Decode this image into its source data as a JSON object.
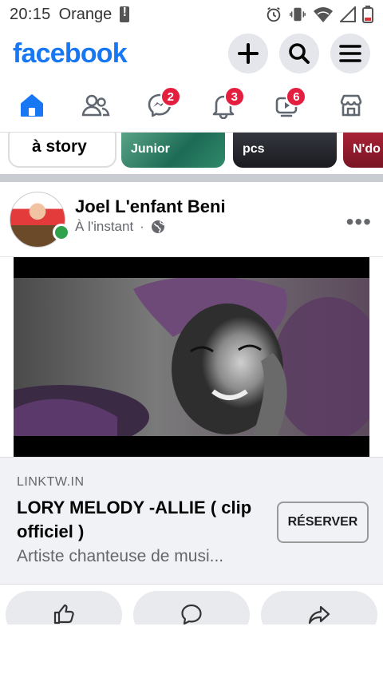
{
  "status_bar": {
    "time": "20:15",
    "carrier": "Orange",
    "icons": [
      "alert-icon",
      "alarm-icon",
      "vibrate-icon",
      "wifi-icon",
      "signal-icon",
      "battery-icon"
    ]
  },
  "header": {
    "logo": "facebook",
    "brand_color": "#1877f2",
    "actions": [
      "plus-icon",
      "search-icon",
      "menu-icon"
    ]
  },
  "nav": {
    "tabs": [
      {
        "name": "home",
        "icon": "home-icon",
        "badge": ""
      },
      {
        "name": "friends",
        "icon": "friends-icon",
        "badge": ""
      },
      {
        "name": "messenger",
        "icon": "messenger-icon",
        "badge": "2"
      },
      {
        "name": "notifications",
        "icon": "bell-icon",
        "badge": "3"
      },
      {
        "name": "watch",
        "icon": "video-icon",
        "badge": "6"
      },
      {
        "name": "marketplace",
        "icon": "store-icon",
        "badge": ""
      }
    ]
  },
  "stories": {
    "create_label": "à story",
    "items": [
      "Junior",
      "pcs",
      "N'do"
    ]
  },
  "post": {
    "author": "Joel L'enfant Beni",
    "time": "À l'instant",
    "separator": "·",
    "privacy_icon": "globe-icon",
    "link": {
      "domain": "LINKTW.IN",
      "title": "LORY MELODY -ALLIE ( clip officiel )",
      "description": "Artiste chanteuse de musi...",
      "cta": "RÉSERVER"
    }
  },
  "post_actions": [
    "like-icon",
    "comment-icon",
    "share-icon"
  ]
}
